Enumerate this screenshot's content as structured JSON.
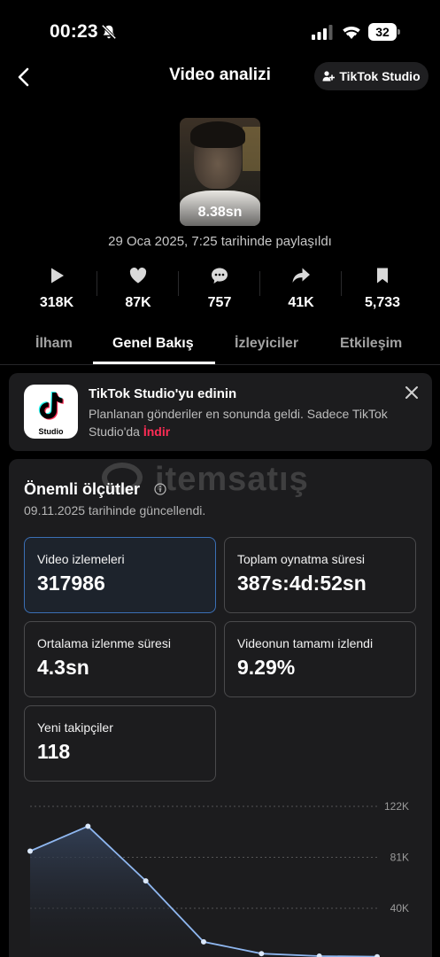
{
  "status_bar": {
    "time": "00:23",
    "battery": "32"
  },
  "header": {
    "title": "Video analizi",
    "studio_button_label": "TikTok Studio"
  },
  "video": {
    "duration": "8.38sn",
    "posted_date": "29 Oca 2025, 7:25 tarihinde paylaşıldı"
  },
  "stats": [
    {
      "icon": "play-icon",
      "value": "318K"
    },
    {
      "icon": "heart-icon",
      "value": "87K"
    },
    {
      "icon": "comment-icon",
      "value": "757"
    },
    {
      "icon": "share-icon",
      "value": "41K"
    },
    {
      "icon": "bookmark-icon",
      "value": "5,733"
    }
  ],
  "tabs": [
    {
      "label": "İlham",
      "active": false
    },
    {
      "label": "Genel Bakış",
      "active": true
    },
    {
      "label": "İzleyiciler",
      "active": false
    },
    {
      "label": "Etkileşim",
      "active": false
    }
  ],
  "banner": {
    "logo_text": "Studio",
    "title": "TikTok Studio'yu edinin",
    "body": "Planlanan gönderiler en sonunda geldi. Sadece TikTok Studio'da ",
    "link": "İndir"
  },
  "key_metrics": {
    "watermark": "itemsatış",
    "title": "Önemli ölçütler",
    "updated": "09.11.2025 tarihinde güncellendi.",
    "tiles": [
      {
        "label": "Video izlemeleri",
        "value": "317986",
        "selected": true
      },
      {
        "label": "Toplam oynatma süresi",
        "value": "387s:4d:52sn",
        "selected": false
      },
      {
        "label": "Ortalama izlenme süresi",
        "value": "4.3sn",
        "selected": false
      },
      {
        "label": "Videonun tamamı izlendi",
        "value": "9.29%",
        "selected": false
      },
      {
        "label": "Yeni takipçiler",
        "value": "118",
        "selected": false
      }
    ]
  },
  "chart_data": {
    "type": "area",
    "title": "",
    "xlabel": "",
    "ylabel": "",
    "y_ticks": [
      "122K",
      "81K",
      "40K"
    ],
    "ylim": [
      0,
      122000
    ],
    "x": [
      1,
      2,
      3,
      4,
      5,
      6,
      7
    ],
    "series": [
      {
        "values": [
          86000,
          106000,
          62000,
          13000,
          3500,
          1500,
          1000
        ]
      }
    ],
    "grid": true,
    "color": "#8fb7f0"
  }
}
